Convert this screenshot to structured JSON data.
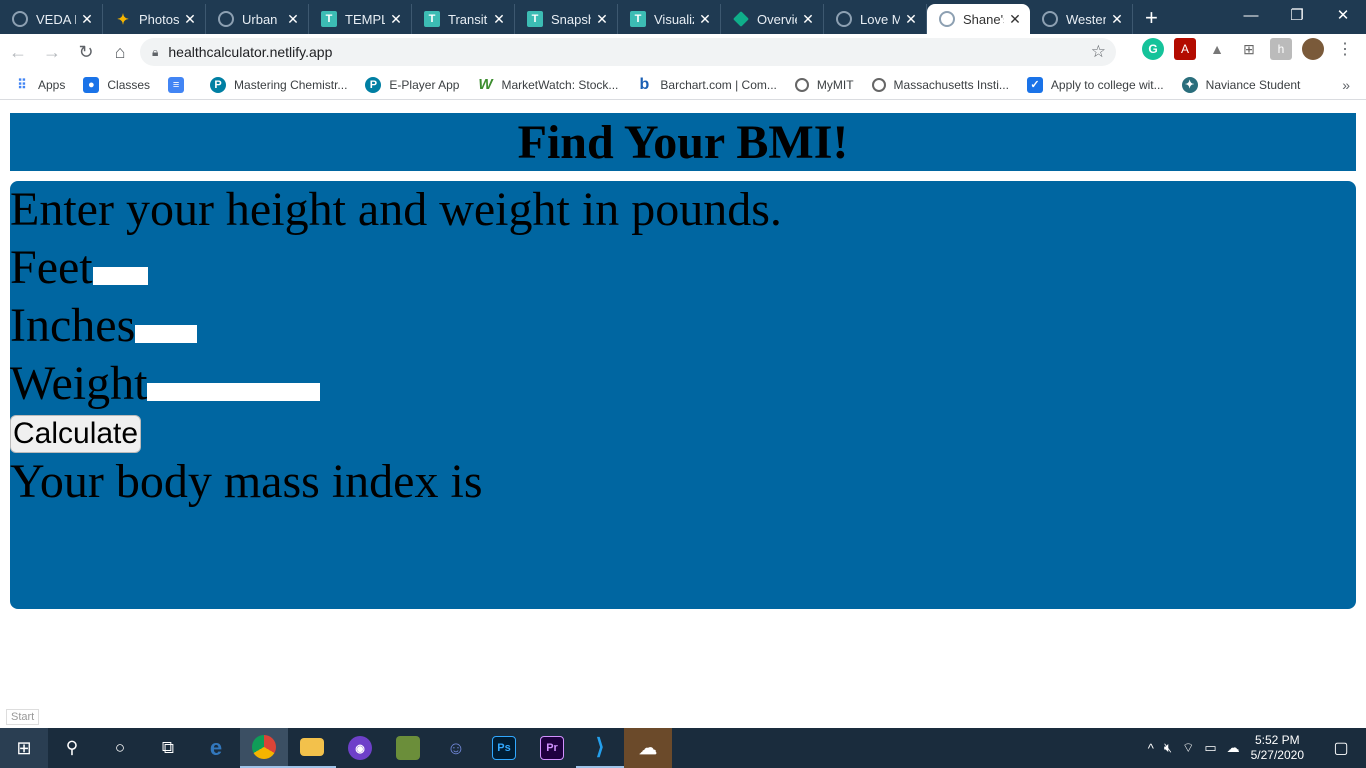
{
  "browser": {
    "tabs": [
      {
        "label": "VEDA B",
        "icon": "globe-icon"
      },
      {
        "label": "Photos",
        "icon": "pinwheel-icon"
      },
      {
        "label": "Urban I",
        "icon": "globe-icon"
      },
      {
        "label": "TEMPL",
        "icon": "t-logo-icon"
      },
      {
        "label": "Transiti",
        "icon": "t-logo-icon"
      },
      {
        "label": "Snapsh",
        "icon": "t-logo-icon"
      },
      {
        "label": "Visualiz",
        "icon": "t-logo-icon"
      },
      {
        "label": "Overvie",
        "icon": "diamond-icon"
      },
      {
        "label": "Love M",
        "icon": "globe-icon"
      },
      {
        "label": "Shane's",
        "icon": "globe-icon"
      },
      {
        "label": "Westen",
        "icon": "globe-icon"
      }
    ],
    "active_tab_index": 9,
    "url": "healthcalculator.netlify.app",
    "bookmarks": [
      {
        "label": "Apps",
        "icon": "apps-grid-icon"
      },
      {
        "label": "Classes",
        "icon": "classes-icon"
      },
      {
        "label": "",
        "icon": "docs-icon"
      },
      {
        "label": "Mastering Chemistr...",
        "icon": "pearson-icon"
      },
      {
        "label": "E-Player App",
        "icon": "pearson-icon"
      },
      {
        "label": "MarketWatch: Stock...",
        "icon": "marketwatch-icon"
      },
      {
        "label": "Barchart.com | Com...",
        "icon": "barchart-icon"
      },
      {
        "label": "MyMIT",
        "icon": "globe-icon"
      },
      {
        "label": "Massachusetts Insti...",
        "icon": "globe-icon"
      },
      {
        "label": "Apply to college wit...",
        "icon": "apply-icon"
      },
      {
        "label": "Naviance Student",
        "icon": "naviance-icon"
      }
    ]
  },
  "page": {
    "heading": "Find Your BMI!",
    "prompt": "Enter your height and weight in pounds.",
    "feet_label": "Feet",
    "feet_value": "",
    "inches_label": "Inches",
    "inches_value": "",
    "weight_label": "Weight",
    "weight_value": "",
    "calculate_label": "Calculate",
    "result_text": "Your body mass index is",
    "start_label": "Start",
    "panel_color": "#0066a1"
  },
  "taskbar": {
    "time": "5:52 PM",
    "date": "5/27/2020"
  }
}
